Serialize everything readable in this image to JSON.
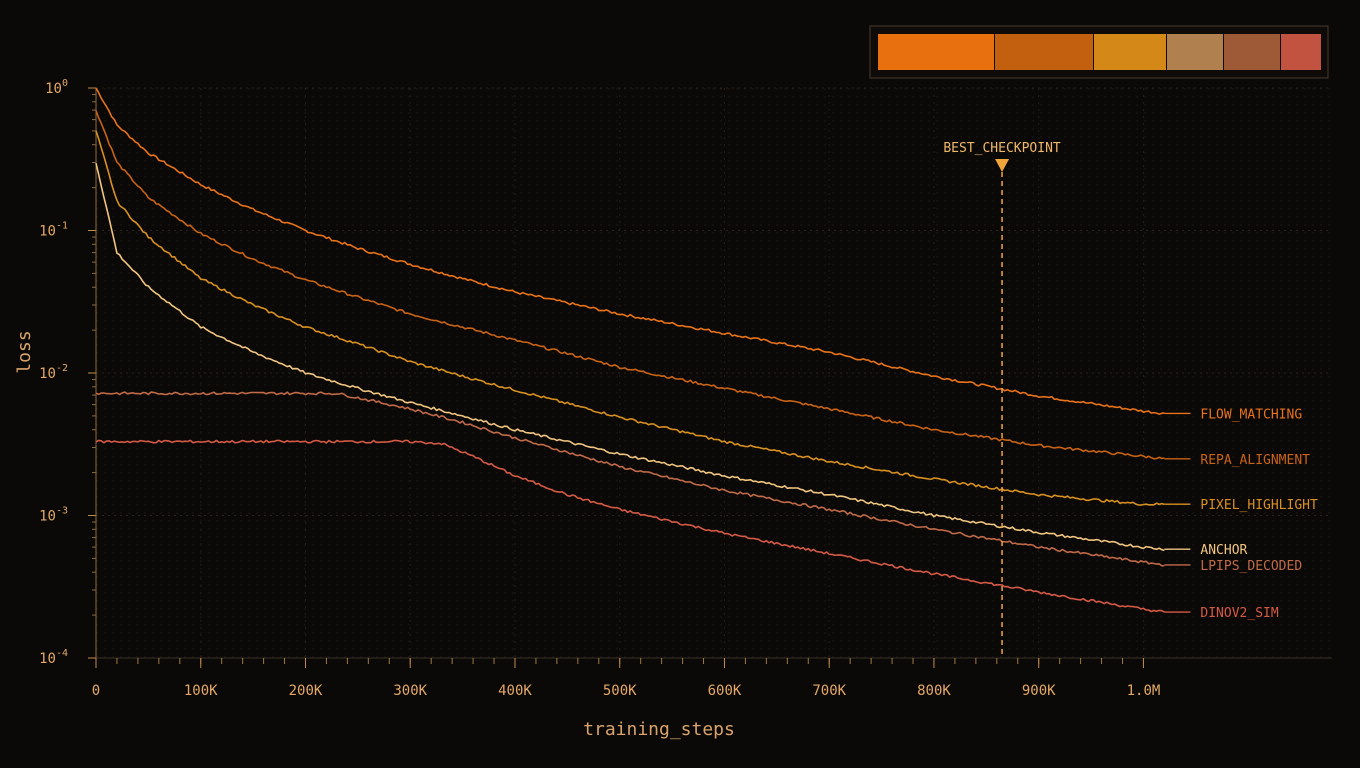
{
  "chart_data": {
    "type": "line",
    "xlabel": "training_steps",
    "ylabel": "loss",
    "y_scale": "log",
    "xlim": [
      0,
      1180000
    ],
    "ylim": [
      0.0001,
      1
    ],
    "x_ticks": [
      {
        "value": 0,
        "label": "0"
      },
      {
        "value": 100000,
        "label": "100K"
      },
      {
        "value": 200000,
        "label": "200K"
      },
      {
        "value": 300000,
        "label": "300K"
      },
      {
        "value": 400000,
        "label": "400K"
      },
      {
        "value": 500000,
        "label": "500K"
      },
      {
        "value": 600000,
        "label": "600K"
      },
      {
        "value": 700000,
        "label": "700K"
      },
      {
        "value": 800000,
        "label": "800K"
      },
      {
        "value": 900000,
        "label": "900K"
      },
      {
        "value": 1000000,
        "label": "1.0M"
      }
    ],
    "y_ticks": [
      {
        "exp": 0,
        "base": "10",
        "sup": "0"
      },
      {
        "exp": -1,
        "base": "10",
        "sup": "-1"
      },
      {
        "exp": -2,
        "base": "10",
        "sup": "-2"
      },
      {
        "exp": -3,
        "base": "10",
        "sup": "-3"
      },
      {
        "exp": -4,
        "base": "10",
        "sup": "-4"
      }
    ],
    "grid": true,
    "legend_placement": "top-right",
    "palette": [
      "#e8700f",
      "#c26010",
      "#d38818",
      "#b0814f",
      "#9e5a37",
      "#c25341"
    ],
    "annotation": {
      "label": "BEST_CHECKPOINT",
      "x": 865000,
      "color": "#f0a63a"
    },
    "series": [
      {
        "name": "FLOW_MATCHING",
        "color": "#e8731a",
        "x": [
          0,
          20000,
          50000,
          100000,
          150000,
          200000,
          250000,
          300000,
          350000,
          400000,
          500000,
          600000,
          700000,
          800000,
          900000,
          1000000,
          1020000
        ],
        "y": [
          1.0,
          0.55,
          0.35,
          0.21,
          0.14,
          0.1,
          0.075,
          0.058,
          0.046,
          0.037,
          0.026,
          0.019,
          0.014,
          0.0095,
          0.0069,
          0.0054,
          0.0052
        ]
      },
      {
        "name": "REPA_ALIGNMENT",
        "color": "#c96316",
        "x": [
          0,
          20000,
          50000,
          100000,
          150000,
          200000,
          250000,
          300000,
          350000,
          400000,
          500000,
          600000,
          700000,
          800000,
          900000,
          1000000,
          1020000
        ],
        "y": [
          0.7,
          0.3,
          0.17,
          0.095,
          0.063,
          0.045,
          0.034,
          0.026,
          0.021,
          0.017,
          0.011,
          0.0078,
          0.0056,
          0.004,
          0.0031,
          0.0026,
          0.0025
        ]
      },
      {
        "name": "PIXEL_HIGHLIGHT",
        "color": "#d89020",
        "x": [
          0,
          20000,
          50000,
          100000,
          150000,
          200000,
          250000,
          300000,
          350000,
          400000,
          500000,
          600000,
          700000,
          800000,
          900000,
          1000000,
          1020000
        ],
        "y": [
          0.5,
          0.16,
          0.09,
          0.046,
          0.03,
          0.021,
          0.016,
          0.012,
          0.0095,
          0.0076,
          0.0049,
          0.0033,
          0.0024,
          0.0018,
          0.0014,
          0.0012,
          0.0012
        ]
      },
      {
        "name": "ANCHOR",
        "color": "#f0c580",
        "x": [
          0,
          20000,
          50000,
          100000,
          150000,
          200000,
          250000,
          300000,
          350000,
          400000,
          500000,
          600000,
          700000,
          800000,
          900000,
          1000000,
          1020000
        ],
        "y": [
          0.3,
          0.07,
          0.04,
          0.021,
          0.014,
          0.01,
          0.0078,
          0.0062,
          0.005,
          0.004,
          0.0027,
          0.0019,
          0.0014,
          0.001,
          0.00076,
          0.0006,
          0.00058
        ]
      },
      {
        "name": "LPIPS_DECODED",
        "color": "#c06a48",
        "x": [
          0,
          20000,
          50000,
          100000,
          150000,
          200000,
          230000,
          250000,
          300000,
          350000,
          400000,
          500000,
          600000,
          700000,
          800000,
          900000,
          1000000,
          1020000
        ],
        "y": [
          0.0072,
          0.0072,
          0.0072,
          0.0072,
          0.0072,
          0.0072,
          0.0072,
          0.0067,
          0.0056,
          0.0045,
          0.0035,
          0.0022,
          0.0015,
          0.0011,
          0.0008,
          0.0006,
          0.00047,
          0.00045
        ]
      },
      {
        "name": "DINOV2_SIM",
        "color": "#d55a45",
        "x": [
          0,
          50000,
          100000,
          200000,
          300000,
          330000,
          360000,
          400000,
          450000,
          500000,
          600000,
          700000,
          800000,
          900000,
          1000000,
          1020000
        ],
        "y": [
          0.0033,
          0.0033,
          0.0033,
          0.0033,
          0.0033,
          0.0032,
          0.0026,
          0.0019,
          0.0014,
          0.0011,
          0.00075,
          0.00054,
          0.00039,
          0.00029,
          0.00022,
          0.00021
        ]
      }
    ]
  }
}
